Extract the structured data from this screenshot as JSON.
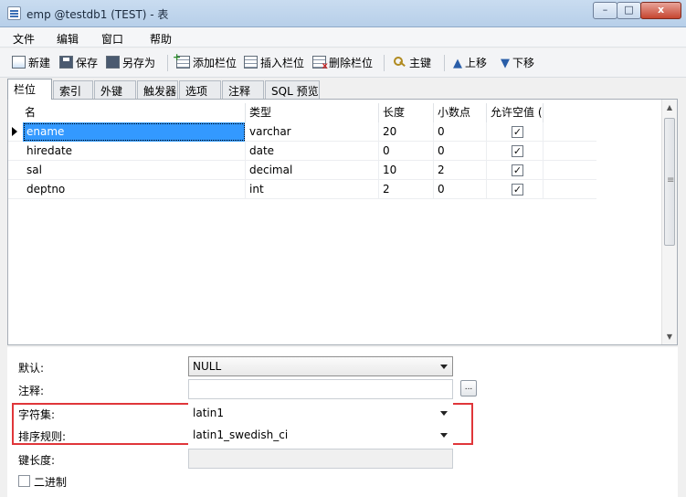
{
  "window": {
    "title": "emp @testdb1 (TEST) - 表",
    "minimize": "–",
    "maximize": "□",
    "close": "x"
  },
  "menu": [
    "文件",
    "编辑",
    "窗口",
    "帮助"
  ],
  "toolbar": {
    "new": "新建",
    "save": "保存",
    "save_as": "另存为",
    "add_column": "添加栏位",
    "insert_column": "插入栏位",
    "delete_column": "删除栏位",
    "primary_key": "主键",
    "move_up": "上移",
    "move_down": "下移"
  },
  "tabs": [
    "栏位",
    "索引",
    "外键",
    "触发器",
    "选项",
    "注释",
    "SQL 预览"
  ],
  "grid": {
    "columns": [
      "名",
      "类型",
      "长度",
      "小数点",
      "允许空值 ("
    ],
    "rows": [
      {
        "name": "ename",
        "type": "varchar",
        "length": "20",
        "decimals": "0",
        "nullable": "✓"
      },
      {
        "name": "hiredate",
        "type": "date",
        "length": "0",
        "decimals": "0",
        "nullable": "✓"
      },
      {
        "name": "sal",
        "type": "decimal",
        "length": "10",
        "decimals": "2",
        "nullable": "✓"
      },
      {
        "name": "deptno",
        "type": "int",
        "length": "2",
        "decimals": "0",
        "nullable": "✓"
      }
    ]
  },
  "properties": {
    "default_label": "默认:",
    "default_value": "NULL",
    "comment_label": "注释:",
    "comment_value": "",
    "comment_button": "...",
    "charset_label": "字符集:",
    "charset_value": "latin1",
    "collation_label": "排序规则:",
    "collation_value": "latin1_swedish_ci",
    "key_length_label": "键长度:",
    "key_length_value": "",
    "binary_label": "二进制"
  },
  "colors": {
    "highlight_border": "#e0363a",
    "selection": "#3399ff"
  }
}
